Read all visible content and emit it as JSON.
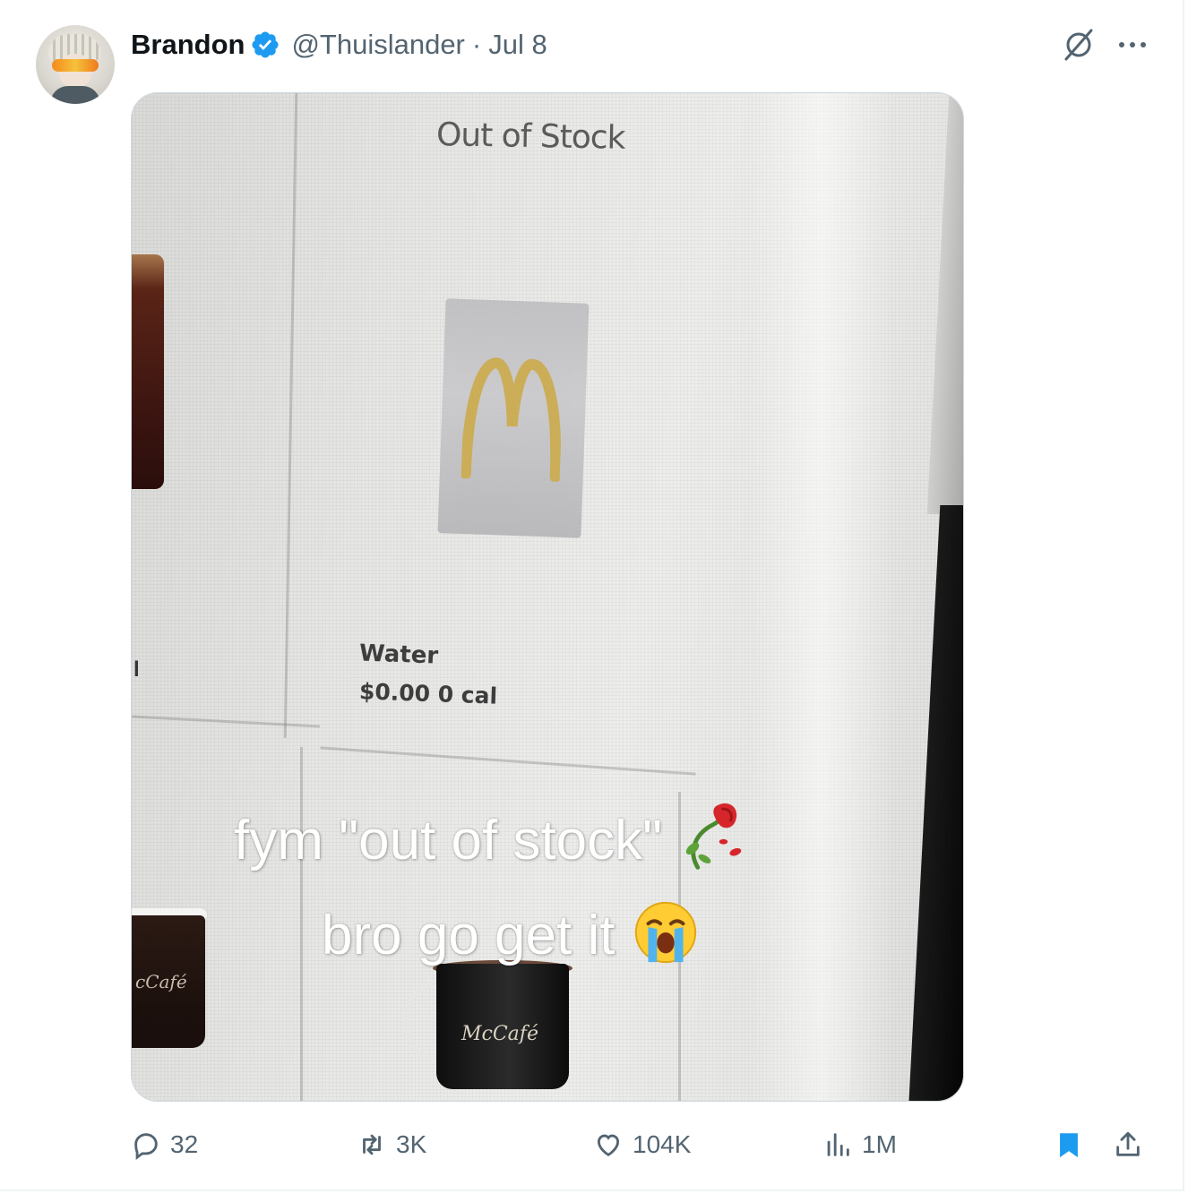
{
  "tweet": {
    "author_name": "Brandon",
    "handle": "@Thuislander",
    "separator": "·",
    "date": "Jul 8"
  },
  "media": {
    "screen_heading": "Out of Stock",
    "item_name": "Water",
    "item_price_cal": "$0.00  0 cal",
    "left_cut_text": "l",
    "mug_brand": "McCafé",
    "mug_brand_left": "cCafé",
    "caption_line1": "fym \"out of stock\"",
    "caption_line2": "bro go get it"
  },
  "actions": {
    "replies": "32",
    "reposts": "3K",
    "likes": "104K",
    "views": "1M"
  },
  "colors": {
    "verified": "#1d9bf0",
    "muted": "#536471",
    "bookmark_active": "#1d9bf0",
    "text": "#0f1419"
  },
  "icons": [
    "verified-badge-icon",
    "grok-icon",
    "more-icon",
    "reply-icon",
    "repost-icon",
    "like-icon",
    "views-icon",
    "bookmark-icon",
    "share-icon",
    "wilted-rose-emoji",
    "crying-face-emoji"
  ]
}
